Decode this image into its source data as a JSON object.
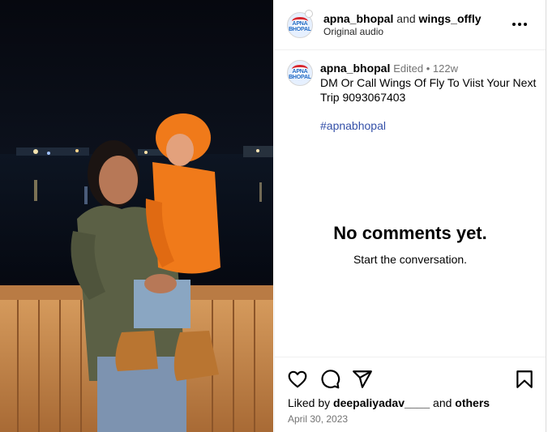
{
  "post": {
    "owner": "apna_bhopal",
    "conjunction": "and",
    "collaborator": "wings_offly",
    "audio": "Original audio",
    "more_icon": "more-horizontal-icon"
  },
  "caption": {
    "username": "apna_bhopal",
    "meta": "Edited • 122w",
    "text": "DM Or Call Wings Of Fly To Viist Your Next Trip 9093067403",
    "hashtag": "#apnabhopal"
  },
  "avatar": {
    "logo_text": "APNA BHOPAL"
  },
  "comments": {
    "empty_title": "No comments yet.",
    "empty_subtitle": "Start the conversation."
  },
  "actions": {
    "icons": [
      "heart-icon",
      "comment-icon",
      "share-icon",
      "bookmark-icon"
    ],
    "liked_by_prefix": "Liked by",
    "liked_by_user": "deepaliyadav____",
    "liked_by_and": "and",
    "liked_by_others": "others",
    "date": "April 30, 2023"
  },
  "colors": {
    "link_blue": "#3450a8",
    "muted_gray": "#737373",
    "jacket_orange": "#f07a1a",
    "jacket_olive": "#5b6045",
    "railing_wood": "#c98a4e"
  }
}
